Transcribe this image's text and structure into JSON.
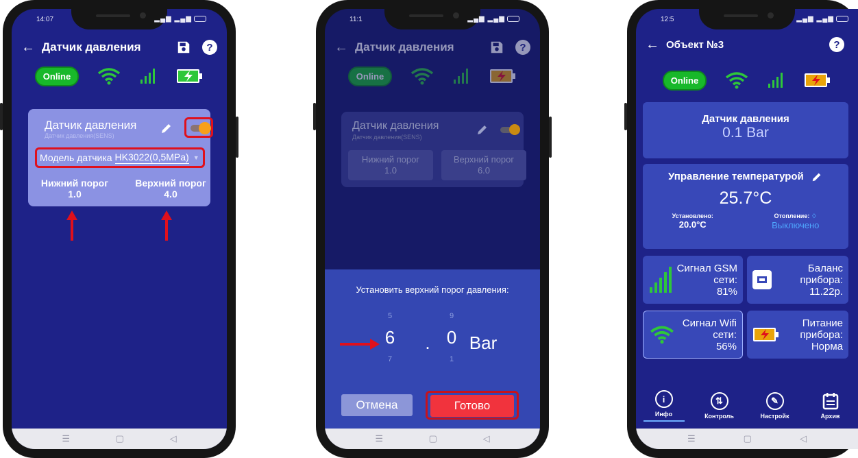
{
  "phones": {
    "p1": {
      "status_time": "14:07",
      "title": "Датчик давления",
      "online": "Online",
      "sensor_name": "Датчик давления",
      "sensor_sub": "Датчик давления(SENS)",
      "model_label": "Модель датчика",
      "model_value": "HK3022(0,5MPa)",
      "lower_label": "Нижний порог",
      "lower_value": "1.0",
      "upper_label": "Верхний порог",
      "upper_value": "4.0"
    },
    "p2": {
      "status_time": "11:1",
      "title": "Датчик давления",
      "online": "Online",
      "sensor_name": "Датчик давления",
      "sensor_sub": "Датчик давления(SENS)",
      "lower_label": "Нижний порог",
      "lower_value": "1.0",
      "upper_label": "Верхний порог",
      "upper_value": "6.0",
      "dialog_title": "Установить верхний порог давления:",
      "picker_int_prev": "5",
      "picker_int": "6",
      "picker_int_next": "7",
      "picker_sep": ".",
      "picker_dec_prev": "9",
      "picker_dec": "0",
      "picker_dec_next": "1",
      "unit": "Bar",
      "cancel": "Отмена",
      "ok": "Готово"
    },
    "p3": {
      "status_time": "12:5",
      "title": "Объект №3",
      "online": "Online",
      "pressure_title": "Датчик давления",
      "pressure_value": "0.1 Bar",
      "temp_title": "Управление температурой",
      "temp_value": "25.7°C",
      "set_label": "Установлено:",
      "set_value": "20.0°C",
      "heat_label": "Отопление:",
      "heat_value": "Выключено",
      "gsm_label": "Сигнал GSM сети:",
      "gsm_value": "81%",
      "balance_label": "Баланс прибора:",
      "balance_value": "11.22р.",
      "wifi_label": "Сигнал Wifi сети:",
      "wifi_value": "56%",
      "power_label": "Питание прибора:",
      "power_value": "Норма",
      "nav": [
        "Инфо",
        "Контроль",
        "Настройк",
        "Архив"
      ]
    }
  },
  "system_nav": [
    "☰",
    "▢",
    "◁"
  ],
  "colors": {
    "screen_bg": "#1e2288",
    "online": "#18b82a",
    "highlight": "#e0101c",
    "accent_orange": "#f7a01a"
  }
}
